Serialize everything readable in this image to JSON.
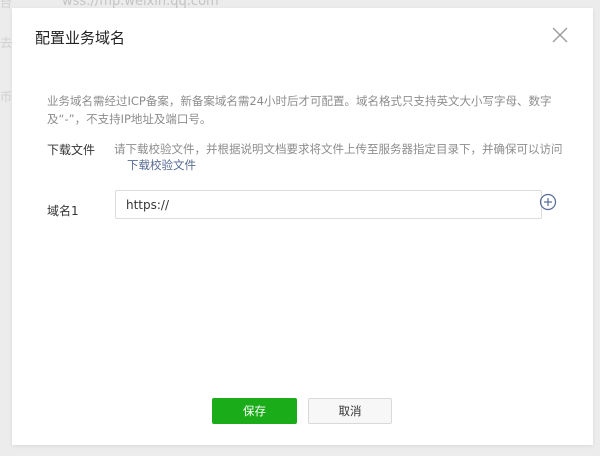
{
  "background": {
    "url_text": "wss://mp.weixin.qq.com",
    "side_chars": [
      "台",
      "去",
      "币"
    ]
  },
  "dialog": {
    "title": "配置业务域名",
    "close_icon": "close-icon",
    "description": "业务域名需经过ICP备案，新备案域名需24小时后才可配置。域名格式只支持英文大小写字母、数字及“-”，不支持IP地址及端口号。",
    "download": {
      "label": "下载文件",
      "text": "请下载校验文件，并根据说明文档要求将文件上传至服务器指定目录下，并确保可以访问",
      "link": "下载校验文件"
    },
    "domain": {
      "label": "域名1",
      "value": "https://",
      "add_icon": "plus-circle-icon"
    },
    "buttons": {
      "save": "保存",
      "cancel": "取消"
    }
  },
  "colors": {
    "primary_green": "#1aad19",
    "link_blue": "#576b95",
    "muted_text": "#8d8d8d"
  }
}
